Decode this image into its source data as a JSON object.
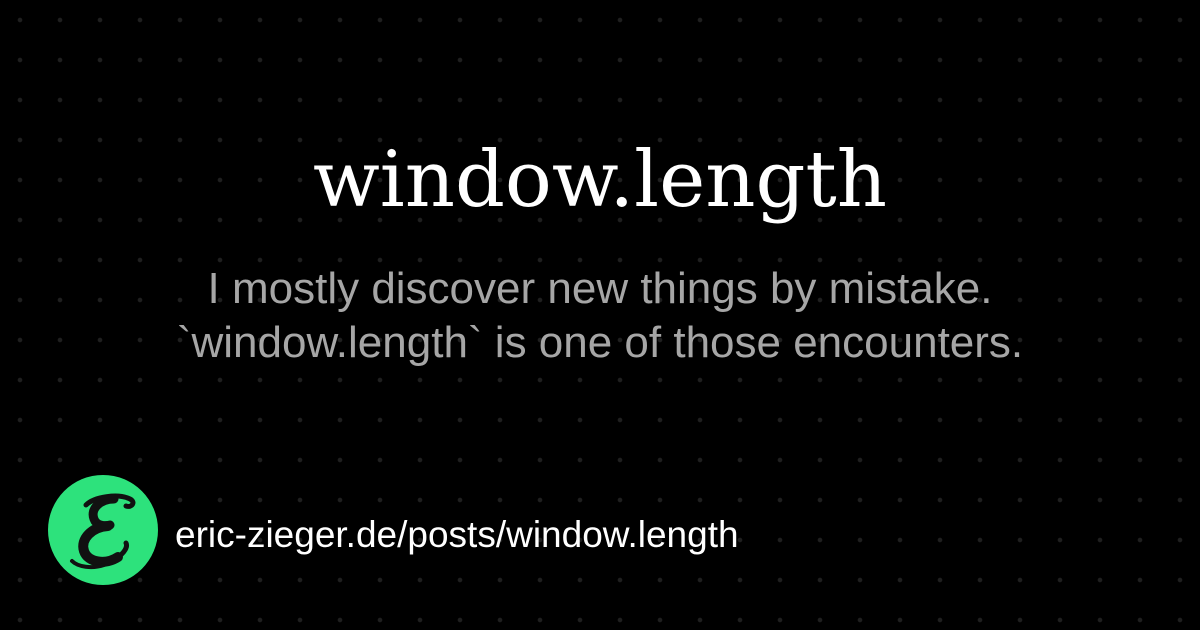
{
  "title": "window.length",
  "subtitle_lines": [
    "I mostly discover new things by mistake.",
    "`window.length` is one of those encounters."
  ],
  "url": "eric-zieger.de/posts/window.length",
  "logo": {
    "letter": "E",
    "background_color": "#2de27c",
    "letter_color": "#111111"
  },
  "colors": {
    "background": "#000000",
    "title": "#ffffff",
    "subtitle": "#a6a6a6",
    "url": "#ffffff"
  }
}
